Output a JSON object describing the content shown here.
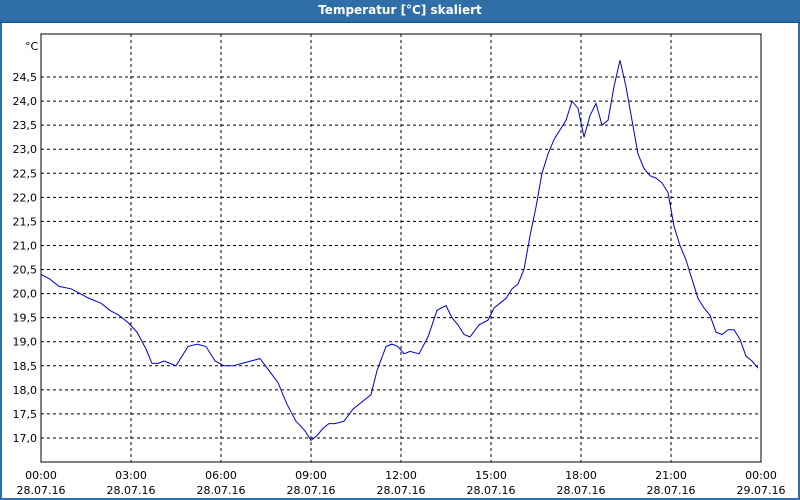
{
  "window": {
    "title": "Temperatur [°C] skaliert"
  },
  "colors": {
    "titlebar": "#2f6ea6",
    "series": "#0000cc",
    "grid": "#000000"
  },
  "chart_data": {
    "type": "line",
    "title": "Temperatur [°C] skaliert",
    "ylabel": "°C",
    "xlabel": "",
    "ylim": [
      16.6,
      25.2
    ],
    "xlim_hours": [
      0,
      24
    ],
    "grid": true,
    "y_ticks": [
      "17,0",
      "17,5",
      "18,0",
      "18,5",
      "19,0",
      "19,5",
      "20,0",
      "20,5",
      "21,0",
      "21,5",
      "22,0",
      "22,5",
      "23,0",
      "23,5",
      "24,0",
      "24,5"
    ],
    "y_tick_values": [
      17.0,
      17.5,
      18.0,
      18.5,
      19.0,
      19.5,
      20.0,
      20.5,
      21.0,
      21.5,
      22.0,
      22.5,
      23.0,
      23.5,
      24.0,
      24.5
    ],
    "x_ticks": [
      {
        "time": "00:00",
        "date": "28.07.16"
      },
      {
        "time": "03:00",
        "date": "28.07.16"
      },
      {
        "time": "06:00",
        "date": "28.07.16"
      },
      {
        "time": "09:00",
        "date": "28.07.16"
      },
      {
        "time": "12:00",
        "date": "28.07.16"
      },
      {
        "time": "15:00",
        "date": "28.07.16"
      },
      {
        "time": "18:00",
        "date": "28.07.16"
      },
      {
        "time": "21:00",
        "date": "28.07.16"
      },
      {
        "time": "00:00",
        "date": "29.07.16"
      }
    ],
    "series": [
      {
        "x_hours": [
          0.0,
          0.3,
          0.6,
          1.0,
          1.3,
          1.6,
          2.0,
          2.3,
          2.6,
          2.9,
          3.2,
          3.5,
          3.7,
          3.9,
          4.1,
          4.3,
          4.5,
          4.7,
          4.9,
          5.2,
          5.5,
          5.8,
          6.1,
          6.4,
          6.7,
          7.0,
          7.3,
          7.6,
          7.9,
          8.2,
          8.5,
          8.8,
          9.0,
          9.2,
          9.4,
          9.6,
          9.8,
          10.1,
          10.4,
          10.7,
          11.0,
          11.2,
          11.5,
          11.7,
          11.9,
          12.1,
          12.3,
          12.6,
          12.9,
          13.2,
          13.5,
          13.7,
          13.9,
          14.1,
          14.3,
          14.6,
          14.9,
          15.1,
          15.3,
          15.5,
          15.7,
          15.9,
          16.1,
          16.3,
          16.5,
          16.7,
          16.9,
          17.1,
          17.3,
          17.5,
          17.7,
          17.9,
          18.1,
          18.3,
          18.5,
          18.7,
          18.9,
          19.1,
          19.3,
          19.5,
          19.7,
          19.9,
          20.1,
          20.3,
          20.5,
          20.7,
          20.9,
          21.1,
          21.3,
          21.5,
          21.7,
          21.9,
          22.1,
          22.3,
          22.5,
          22.7,
          22.9,
          23.1,
          23.3,
          23.5,
          23.7,
          23.9
        ],
        "values": [
          20.4,
          20.3,
          20.15,
          20.1,
          20.0,
          19.9,
          19.8,
          19.65,
          19.55,
          19.4,
          19.2,
          18.85,
          18.55,
          18.55,
          18.6,
          18.55,
          18.5,
          18.7,
          18.9,
          18.95,
          18.9,
          18.6,
          18.5,
          18.5,
          18.55,
          18.6,
          18.65,
          18.4,
          18.15,
          17.7,
          17.35,
          17.15,
          16.95,
          17.05,
          17.2,
          17.3,
          17.3,
          17.35,
          17.6,
          17.75,
          17.9,
          18.4,
          18.9,
          18.95,
          18.9,
          18.75,
          18.8,
          18.75,
          19.1,
          19.65,
          19.75,
          19.5,
          19.35,
          19.15,
          19.1,
          19.35,
          19.45,
          19.7,
          19.8,
          19.9,
          20.1,
          20.2,
          20.5,
          21.2,
          21.8,
          22.5,
          22.9,
          23.2,
          23.4,
          23.6,
          24.0,
          23.85,
          23.25,
          23.7,
          23.95,
          23.5,
          23.6,
          24.3,
          24.85,
          24.3,
          23.6,
          22.9,
          22.6,
          22.45,
          22.4,
          22.3,
          22.1,
          21.4,
          21.0,
          20.7,
          20.3,
          19.9,
          19.7,
          19.55,
          19.2,
          19.15,
          19.25,
          19.25,
          19.05,
          18.7,
          18.6,
          18.45
        ]
      }
    ]
  }
}
